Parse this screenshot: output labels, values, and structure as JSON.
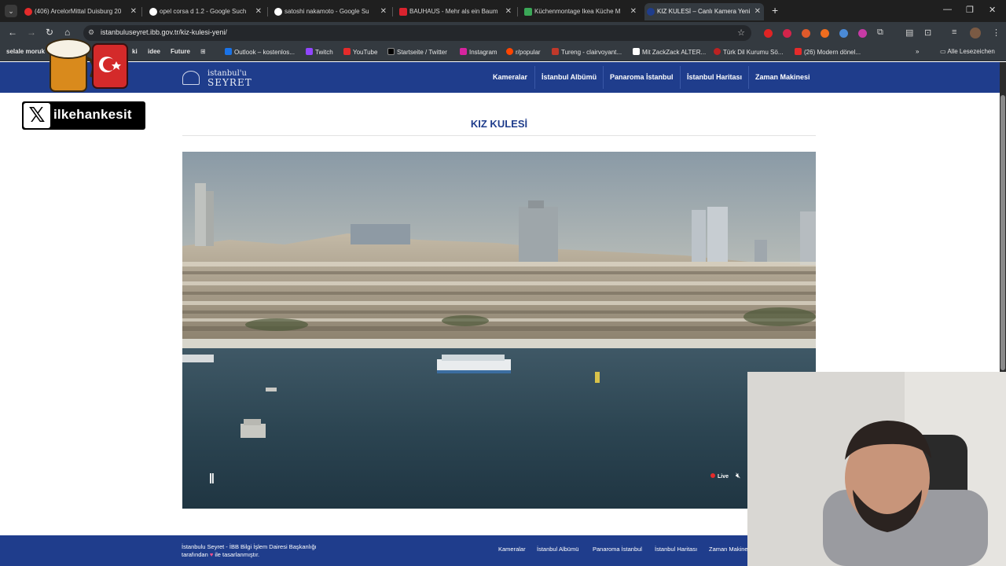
{
  "browser": {
    "tabs": [
      {
        "title": "(406) ArcelorMittal Duisburg 20",
        "active": false
      },
      {
        "title": "opel corsa d 1.2 - Google Such",
        "active": false
      },
      {
        "title": "satoshi nakamoto - Google Su",
        "active": false
      },
      {
        "title": "BAUHAUS - Mehr als ein Baum",
        "active": false
      },
      {
        "title": "Küchenmontage Ikea Küche M",
        "active": false
      },
      {
        "title": "KIZ KULESİ – Canlı Kamera Yeni",
        "active": true
      }
    ],
    "address": "istanbuluseyret.ibb.gov.tr/kiz-kulesi-yeni/",
    "bookmarks": [
      "selale moruk",
      "ki",
      "idee",
      "Future",
      "Outlook – kostenlos...",
      "Twitch",
      "YouTube",
      "Startseite / Twitter",
      "Instagram",
      "r/popular",
      "Tureng - clairvoyant...",
      "Mit ZackZack ALTER...",
      "Türk Dil Kurumu Sö...",
      "(26) Modern dönel..."
    ],
    "all_bookmarks": "Alle Lesezeichen",
    "colors": {
      "chrome": "#343a40",
      "tabstrip": "#1f1f1f"
    }
  },
  "site": {
    "logo_line1": "istanbul'u",
    "logo_line2": "SEYRET",
    "nav": [
      "Kameralar",
      "İstanbul Albümü",
      "Panaroma İstanbul",
      "İstanbul Haritası",
      "Zaman Makinesi"
    ],
    "page_title": "KIZ KULESİ",
    "player": {
      "live_label": "Live",
      "pause_symbol": "||"
    },
    "footer": {
      "line1": "İstanbulu Seyret - İBB Bilgi İşlem Dairesi Başkanlığı",
      "line2_before": "tarafından",
      "heart": "♥",
      "line2_after": "ile tasarlanmıştır.",
      "links": [
        "Kameralar",
        "İstanbul Albümü",
        "Panaroma İstanbul",
        "İstanbul Haritası",
        "Zaman Makinesi"
      ]
    },
    "colors": {
      "brand": "#1f3d8c",
      "live": "#e52b2b"
    }
  },
  "overlay": {
    "x_handle": "ilkehankesit",
    "x_logo": "𝕏"
  }
}
